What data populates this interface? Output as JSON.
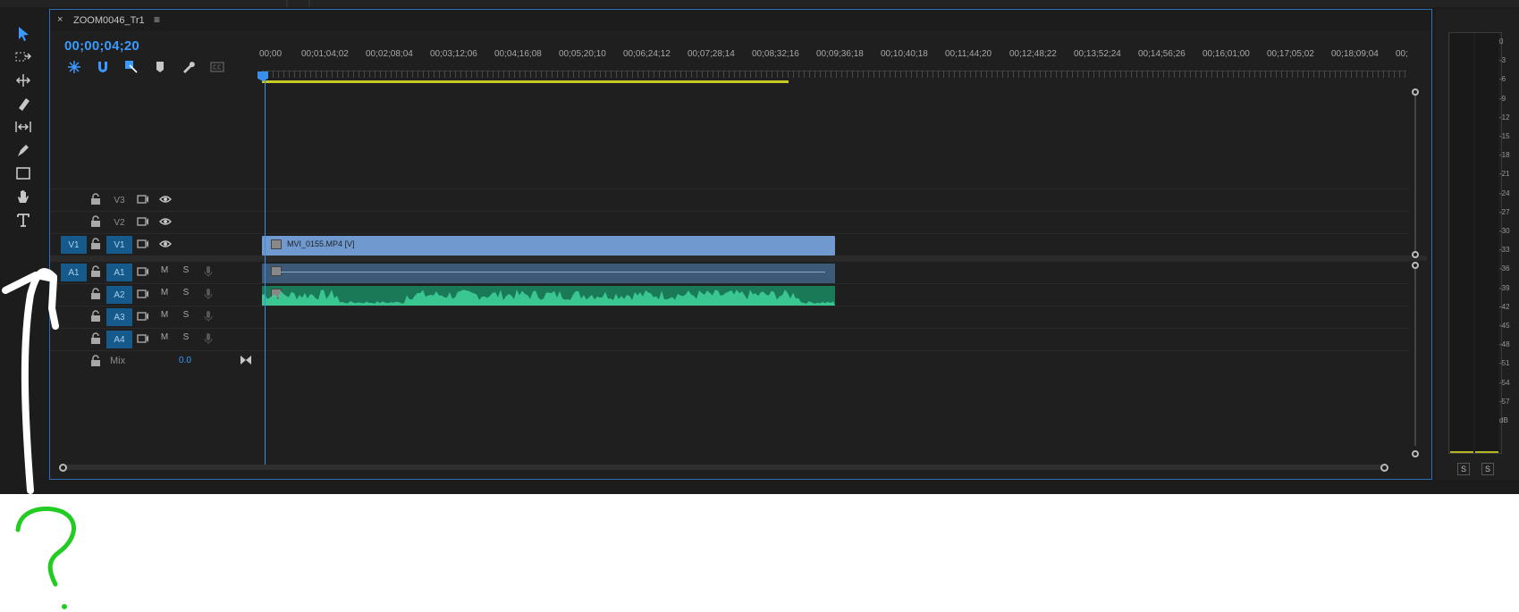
{
  "sequence_tab": {
    "close": "×",
    "title": "ZOOM0046_Tr1",
    "menu": "≡"
  },
  "timecode": "00;00;04;20",
  "ruler_labels": [
    "00;00",
    "00;01;04;02",
    "00;02;08;04",
    "00;03;12;06",
    "00;04;16;08",
    "00;05;20;10",
    "00;06;24;12",
    "00;07;28;14",
    "00;08;32;16",
    "00;09;36;18",
    "00;10;40;18",
    "00;11;44;20",
    "00;12;48;22",
    "00;13;52;24",
    "00;14;56;26",
    "00;16;01;00",
    "00;17;05;02",
    "00;18;09;04",
    "00;"
  ],
  "video_tracks": [
    {
      "name": "V3",
      "source": ""
    },
    {
      "name": "V2",
      "source": ""
    },
    {
      "name": "V1",
      "source": "V1"
    }
  ],
  "audio_tracks": [
    {
      "name": "A1",
      "source": "A1",
      "m": "M",
      "s": "S"
    },
    {
      "name": "A2",
      "source": "",
      "m": "M",
      "s": "S"
    },
    {
      "name": "A3",
      "source": "",
      "m": "M",
      "s": "S"
    },
    {
      "name": "A4",
      "source": "",
      "m": "M",
      "s": "S"
    }
  ],
  "mix": {
    "label": "Mix",
    "value": "0.0"
  },
  "clip": {
    "name": "MVI_0155.MP4 [V]"
  },
  "meter": {
    "db_labels": [
      "0",
      "-3",
      "-6",
      "-9",
      "-12",
      "-15",
      "-18",
      "-21",
      "-24",
      "-27",
      "-30",
      "-33",
      "-36",
      "-39",
      "-42",
      "-45",
      "-48",
      "-51",
      "-54",
      "-57",
      "dB"
    ],
    "solo_left": "S",
    "solo_right": "S"
  },
  "annotation": {
    "symbol": "?"
  },
  "colors": {
    "accent": "#3a9aff",
    "video_clip": "#6f99cf",
    "audio_clip": "#1a7a58",
    "annotation_arrow": "#ffffff",
    "annotation_question": "#22cc22"
  }
}
